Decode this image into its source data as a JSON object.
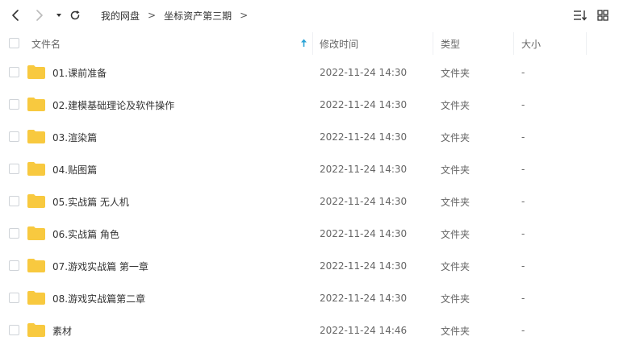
{
  "breadcrumb": {
    "items": [
      "我的网盘",
      "坐标资产第三期"
    ],
    "separator": ">",
    "trailing": ">"
  },
  "icons": {
    "back": "chevron-left-icon",
    "forward": "chevron-right-icon",
    "history": "caret-down-icon",
    "refresh": "refresh-icon",
    "sort": "sort-list-icon",
    "grid": "grid-view-icon",
    "folder": "folder-icon",
    "sort_asc": "arrow-up-icon"
  },
  "colors": {
    "folder": "#f8c93f",
    "sort_arrow": "#2aa3d6"
  },
  "columns": {
    "name": "文件名",
    "modified": "修改时间",
    "type": "类型",
    "size": "大小"
  },
  "rows": [
    {
      "name": "01.课前准备",
      "modified": "2022-11-24 14:30",
      "type": "文件夹",
      "size": "-"
    },
    {
      "name": "02.建模基础理论及软件操作",
      "modified": "2022-11-24 14:30",
      "type": "文件夹",
      "size": "-"
    },
    {
      "name": "03.渲染篇",
      "modified": "2022-11-24 14:30",
      "type": "文件夹",
      "size": "-"
    },
    {
      "name": "04.贴图篇",
      "modified": "2022-11-24 14:30",
      "type": "文件夹",
      "size": "-"
    },
    {
      "name": "05.实战篇 无人机",
      "modified": "2022-11-24 14:30",
      "type": "文件夹",
      "size": "-"
    },
    {
      "name": "06.实战篇 角色",
      "modified": "2022-11-24 14:30",
      "type": "文件夹",
      "size": "-"
    },
    {
      "name": "07.游戏实战篇 第一章",
      "modified": "2022-11-24 14:30",
      "type": "文件夹",
      "size": "-"
    },
    {
      "name": "08.游戏实战篇第二章",
      "modified": "2022-11-24 14:30",
      "type": "文件夹",
      "size": "-"
    },
    {
      "name": "素材",
      "modified": "2022-11-24 14:46",
      "type": "文件夹",
      "size": "-"
    }
  ]
}
